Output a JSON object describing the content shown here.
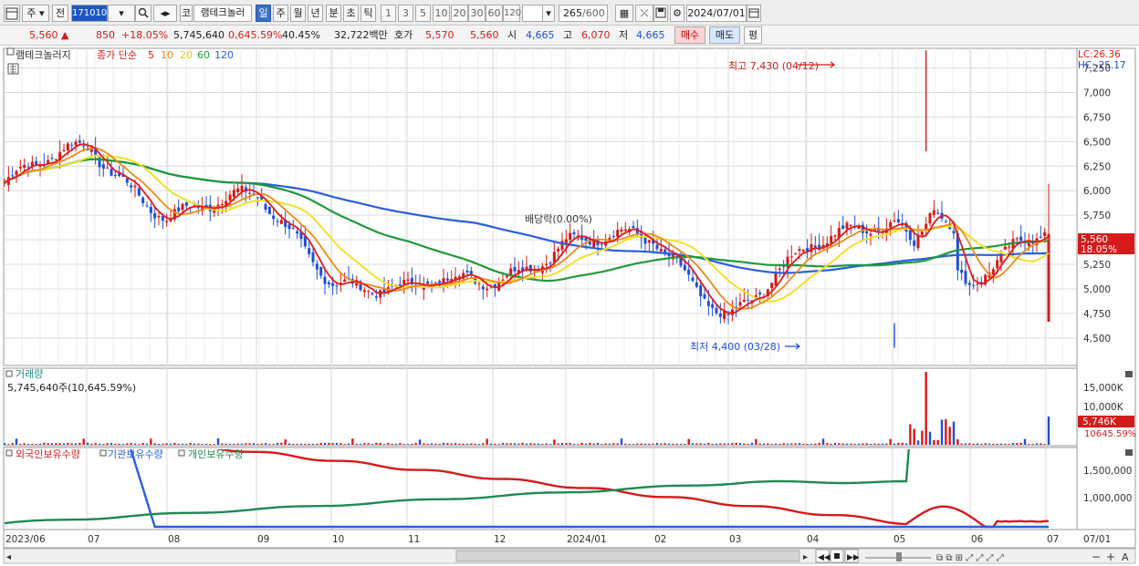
{
  "toolbar": {
    "period_weekly": "주",
    "prev_label": "전",
    "code_value": "171010",
    "code_prefix": "코",
    "stock_name": "램테크놀러",
    "periods": [
      "일",
      "주",
      "월",
      "년",
      "분",
      "초",
      "틱"
    ],
    "active_period": "일",
    "intervals": [
      "1",
      "3",
      "5",
      "10",
      "20",
      "30",
      "60",
      "120"
    ],
    "count_value": "265",
    "count_total": "/600",
    "date_value": "2024/07/01"
  },
  "quote": {
    "price": "5,560",
    "change": "850",
    "change_pct": "+18.05%",
    "volume": "5,745,640",
    "volume_pct": "0,645.59%",
    "turnover": "40.45%",
    "amount": "32,722백만",
    "ask_label": "호가",
    "ask_value": "5,570",
    "bid_value": "5,560",
    "open_label": "시",
    "open_value": "4,665",
    "high_label": "고",
    "high_value": "6,070",
    "low_label": "저",
    "low_value": "4,665",
    "buy_label": "매수",
    "sell_label": "매도",
    "eval_label": "평"
  },
  "price_panel": {
    "legend_name": "램테크놀러지",
    "legend_desc": "종가 단순",
    "ma_periods": [
      "5",
      "10",
      "20",
      "60",
      "120"
    ],
    "ma_colors": [
      "#e01b1b",
      "#ef8a16",
      "#f2e02a",
      "#1f9a3a",
      "#2a5ee0"
    ],
    "lc": "LC:26.36",
    "hc": "HC:-25.17",
    "high_note": "최고 7,430 (04/12)",
    "low_note": "최저 4,400 (03/28)",
    "dividend_note": "배당락(0.00%)",
    "last_price_tag": "5,560",
    "last_pct_tag": "18.05%"
  },
  "volume_panel": {
    "title": "거래량",
    "value_text": "5,745,640주(10,645.59%)",
    "last_tag": "5,746K",
    "last_pct_tag": "10645.59%"
  },
  "holdings_panel": {
    "legend": [
      "외국인보유수량",
      "기관보유수량",
      "개인보유수량"
    ],
    "colors": [
      "#d61a1a",
      "#2a5ee0",
      "#1f8a50"
    ]
  },
  "x_axis": {
    "labels": [
      "2023/06",
      "07",
      "08",
      "09",
      "10",
      "11",
      "12",
      "2024/01",
      "02",
      "03",
      "04",
      "05",
      "06",
      "07"
    ],
    "right_label": "07/01"
  },
  "chart_data": {
    "type": "candlestick",
    "period": "daily",
    "date_range": [
      "2023/06",
      "2024/07/01"
    ],
    "y_ticks": [
      4500,
      4750,
      5000,
      5250,
      5500,
      5750,
      6000,
      6250,
      6500,
      6750,
      7000,
      7250
    ],
    "ylim": [
      4220,
      7450
    ],
    "close_by_month": [
      {
        "x": "2023/06",
        "close": 6080
      },
      {
        "x": "07",
        "close": 6420
      },
      {
        "x": "08",
        "close": 5800
      },
      {
        "x": "09",
        "close": 5880
      },
      {
        "x": "10",
        "close": 5150
      },
      {
        "x": "11",
        "close": 4950
      },
      {
        "x": "12",
        "close": 5100
      },
      {
        "x": "2024/01",
        "close": 5500
      },
      {
        "x": "02",
        "close": 5450
      },
      {
        "x": "03",
        "close": 4780
      },
      {
        "x": "04",
        "close": 5350
      },
      {
        "x": "05",
        "close": 5750
      },
      {
        "x": "06",
        "close": 5000
      },
      {
        "x": "07/01",
        "close": 5560
      }
    ],
    "high": {
      "value": 7430,
      "date": "04/12"
    },
    "low": {
      "value": 4400,
      "date": "03/28"
    },
    "last": {
      "open": 4665,
      "high": 6070,
      "low": 4665,
      "close": 5560
    },
    "volume_ticks": [
      "10,000K",
      "15,000K"
    ],
    "holdings_ticks": [
      "1,000,000",
      "1,500,000"
    ]
  }
}
